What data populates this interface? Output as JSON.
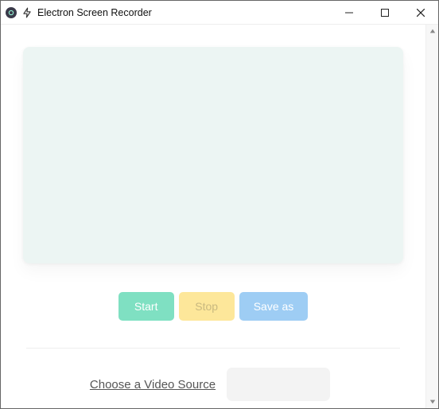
{
  "window": {
    "title": "Electron Screen Recorder"
  },
  "controls": {
    "start_label": "Start",
    "stop_label": "Stop",
    "save_label": "Save as"
  },
  "source": {
    "label": "Choose a Video Source"
  }
}
